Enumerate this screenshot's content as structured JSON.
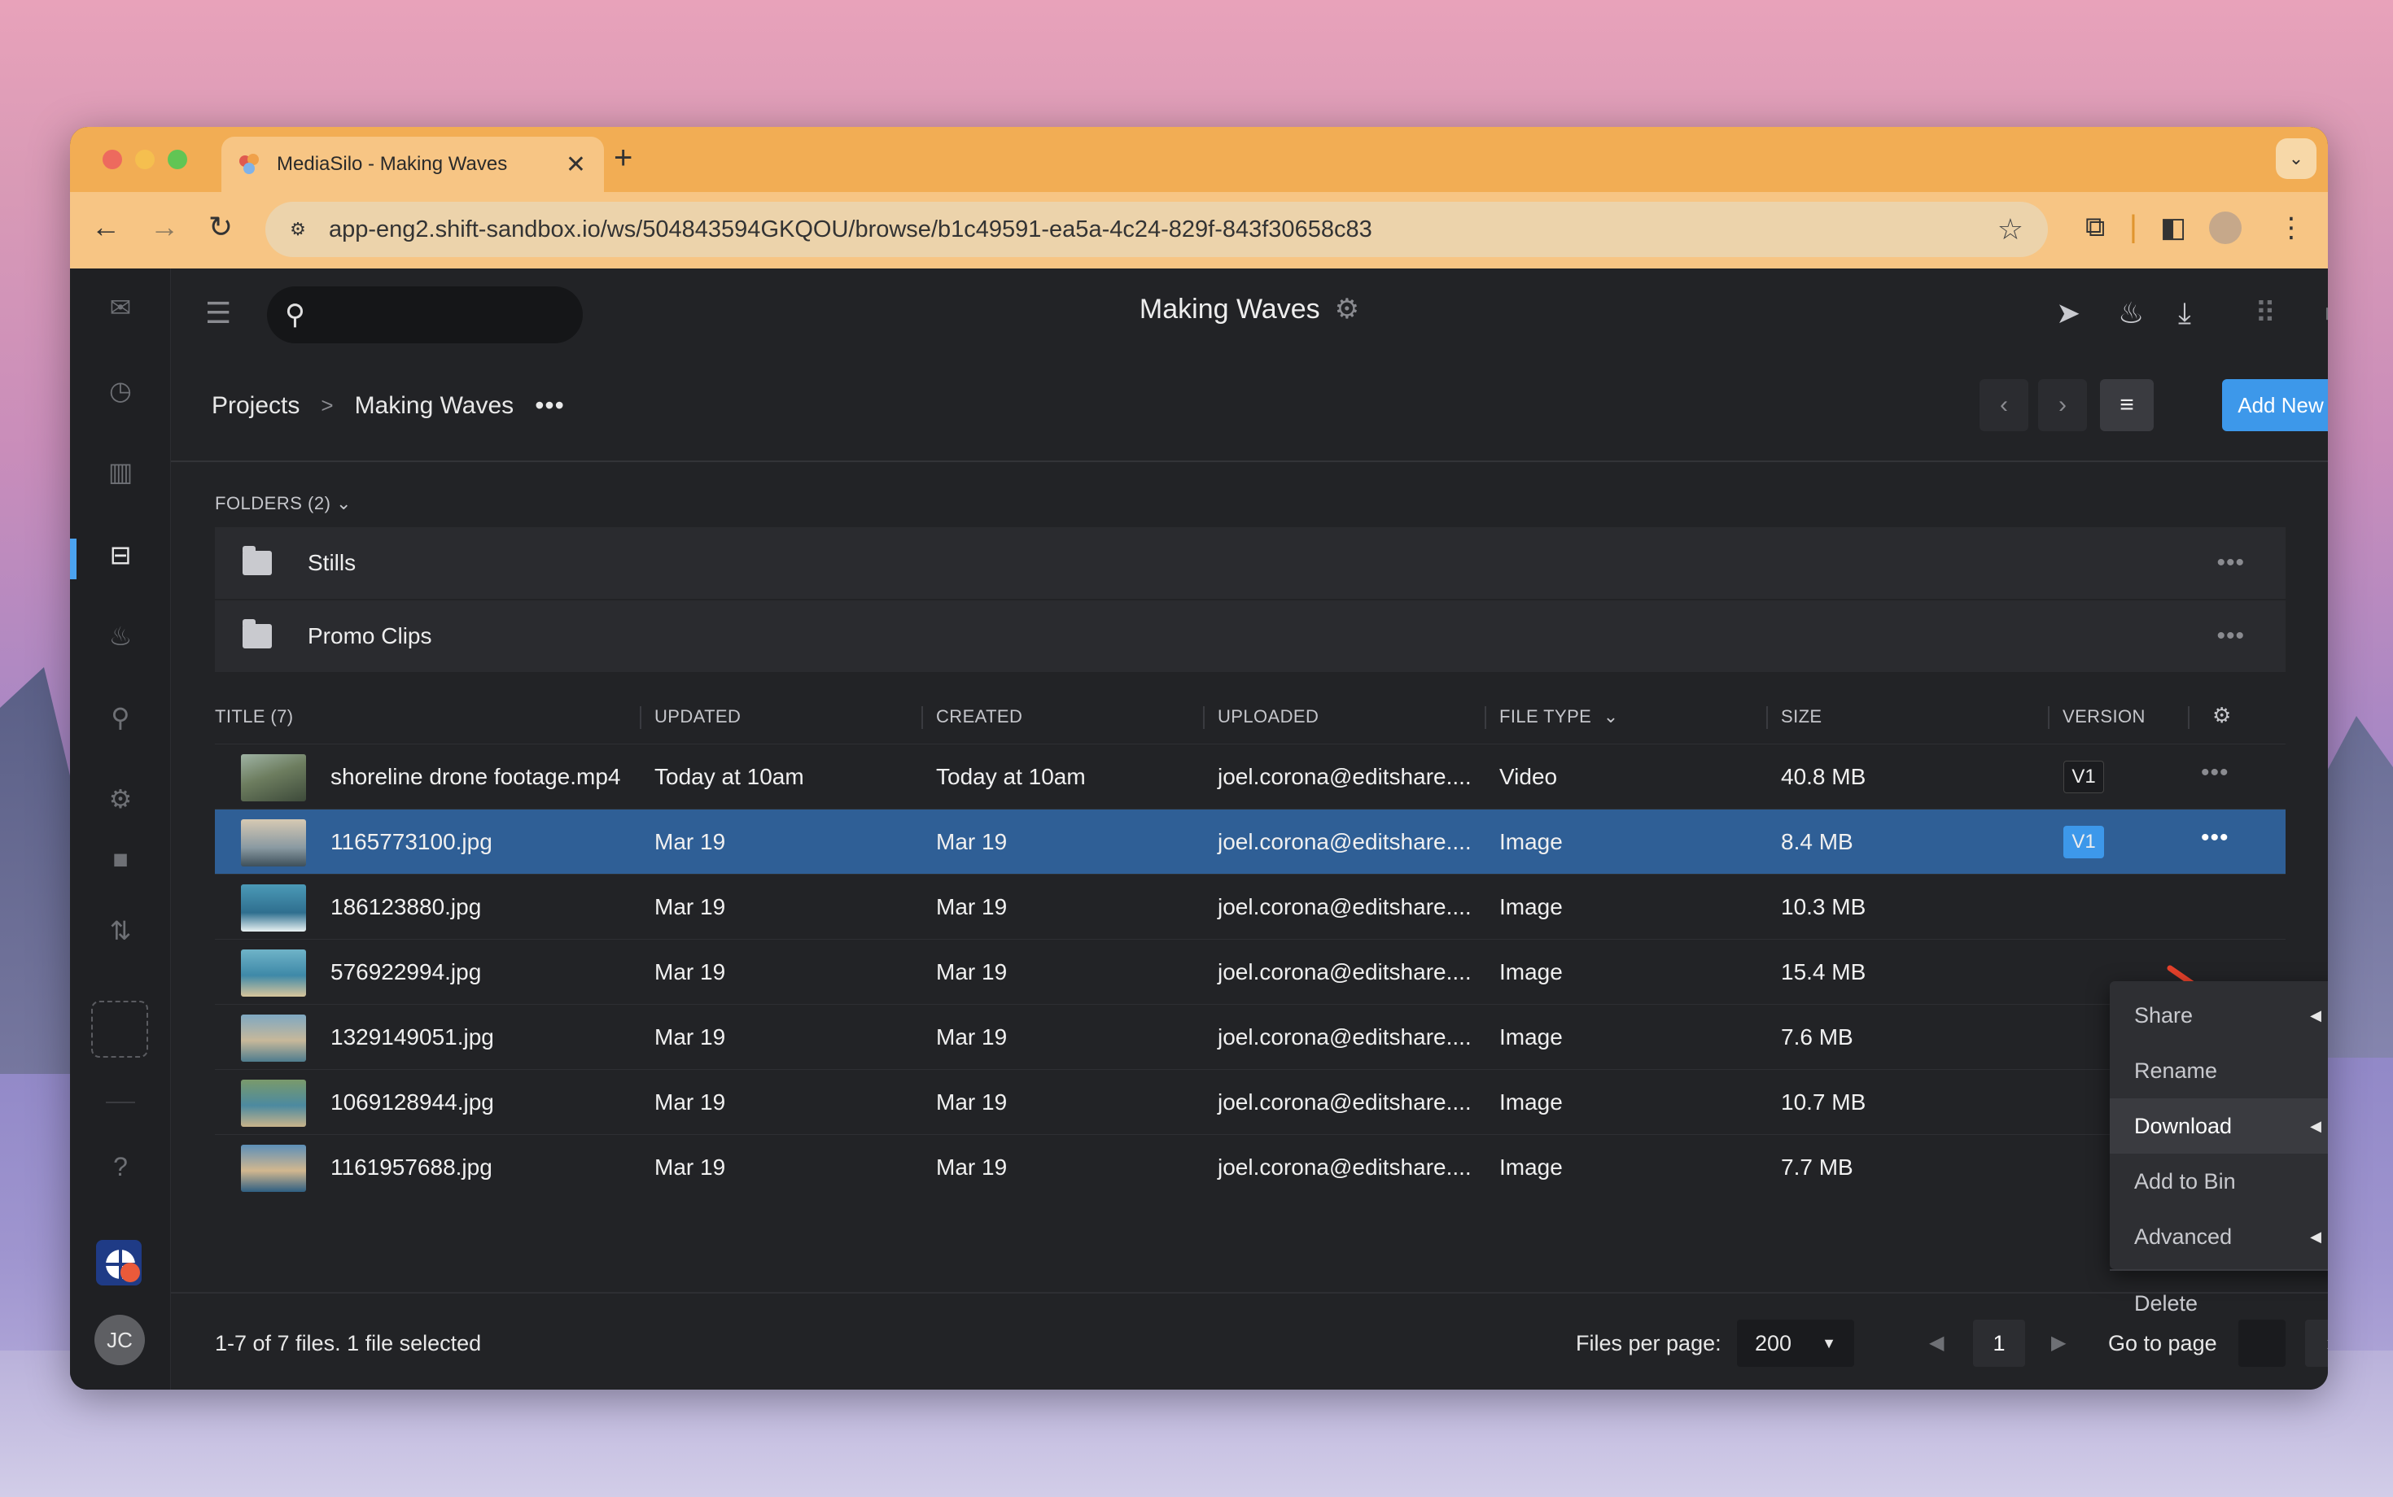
{
  "browser": {
    "tab_title": "MediaSilo - Making Waves",
    "tab_close": "✕",
    "new_tab": "+",
    "url": "app-eng2.shift-sandbox.io/ws/504843594GKQOU/browse/b1c49591-ea5a-4c24-829f-843f30658c83"
  },
  "header": {
    "title": "Making Waves"
  },
  "breadcrumb": {
    "root": "Projects",
    "separator": ">",
    "current": "Making Waves",
    "more": "•••"
  },
  "actions": {
    "add_new": "Add New"
  },
  "folders": {
    "label": "FOLDERS (2)",
    "items": [
      {
        "name": "Stills"
      },
      {
        "name": "Promo Clips"
      }
    ]
  },
  "table": {
    "columns": {
      "title": "TITLE (7)",
      "updated": "UPDATED",
      "created": "CREATED",
      "uploaded": "UPLOADED",
      "file_type": "FILE TYPE",
      "size": "SIZE",
      "version": "VERSION"
    },
    "rows": [
      {
        "title": "shoreline drone footage.mp4",
        "updated": "Today at 10am",
        "created": "Today at 10am",
        "uploaded": "joel.corona@editshare....",
        "file_type": "Video",
        "size": "40.8 MB",
        "version": "V1",
        "selected": false
      },
      {
        "title": "1165773100.jpg",
        "updated": "Mar 19",
        "created": "Mar 19",
        "uploaded": "joel.corona@editshare....",
        "file_type": "Image",
        "size": "8.4 MB",
        "version": "V1",
        "selected": true
      },
      {
        "title": "186123880.jpg",
        "updated": "Mar 19",
        "created": "Mar 19",
        "uploaded": "joel.corona@editshare....",
        "file_type": "Image",
        "size": "10.3 MB",
        "version": "",
        "selected": false
      },
      {
        "title": "576922994.jpg",
        "updated": "Mar 19",
        "created": "Mar 19",
        "uploaded": "joel.corona@editshare....",
        "file_type": "Image",
        "size": "15.4 MB",
        "version": "",
        "selected": false
      },
      {
        "title": "1329149051.jpg",
        "updated": "Mar 19",
        "created": "Mar 19",
        "uploaded": "joel.corona@editshare....",
        "file_type": "Image",
        "size": "7.6 MB",
        "version": "",
        "selected": false
      },
      {
        "title": "1069128944.jpg",
        "updated": "Mar 19",
        "created": "Mar 19",
        "uploaded": "joel.corona@editshare....",
        "file_type": "Image",
        "size": "10.7 MB",
        "version": "",
        "selected": false
      },
      {
        "title": "1161957688.jpg",
        "updated": "Mar 19",
        "created": "Mar 19",
        "uploaded": "joel.corona@editshare....",
        "file_type": "Image",
        "size": "7.7 MB",
        "version": "",
        "selected": false
      }
    ]
  },
  "context_menu": {
    "items": [
      "Share",
      "Rename",
      "Download",
      "Add to Bin",
      "Advanced",
      "Delete"
    ]
  },
  "footer": {
    "count": "1-7 of 7 files. 1 file selected",
    "per_page_label": "Files per page:",
    "per_page_value": "200",
    "page": "1",
    "goto_label": "Go to page"
  },
  "user": {
    "initials": "JC"
  },
  "colors": {
    "accent": "#3d98ea",
    "selected_row": "#2f5f96",
    "tab_bar": "#f2ad54",
    "annotation_arrow": "#e5412b"
  }
}
